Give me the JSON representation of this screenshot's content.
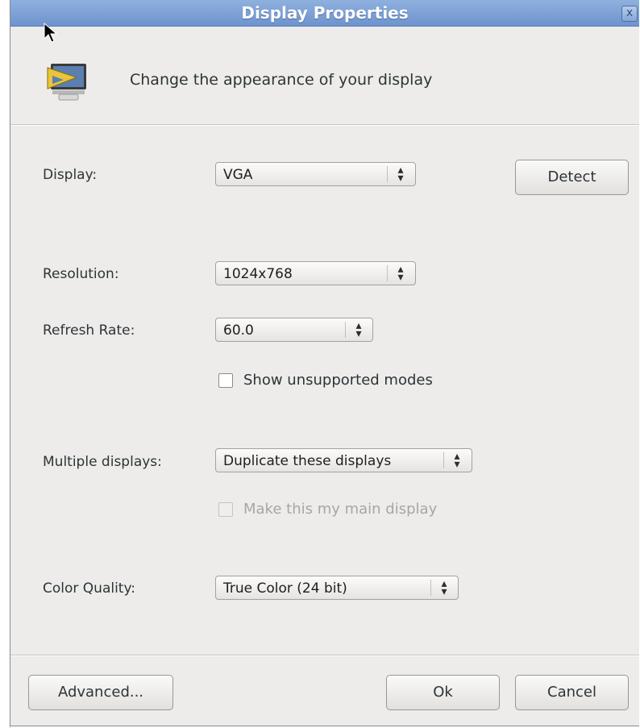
{
  "window": {
    "title": "Display Properties",
    "close_glyph": "x",
    "header_text": "Change the appearance of your display",
    "header_icon": "display-settings-icon"
  },
  "display": {
    "label": "Display:",
    "value": "VGA"
  },
  "detect_button": "Detect",
  "resolution": {
    "label": "Resolution:",
    "value": "1024x768"
  },
  "refresh_rate": {
    "label": "Refresh Rate:",
    "value": "60.0"
  },
  "show_unsupported": {
    "label": "Show unsupported modes",
    "checked": false
  },
  "multiple_displays": {
    "label": "Multiple displays:",
    "value": "Duplicate these displays"
  },
  "main_display": {
    "label": "Make this my main display",
    "checked": false,
    "enabled": false
  },
  "color_quality": {
    "label": "Color Quality:",
    "value": "True Color (24 bit)"
  },
  "buttons": {
    "advanced": "Advanced...",
    "ok": "Ok",
    "cancel": "Cancel"
  },
  "combo_arrows": "▲▼",
  "colors": {
    "titlebar": "#7c9fd6",
    "window_bg": "#edeceb"
  }
}
